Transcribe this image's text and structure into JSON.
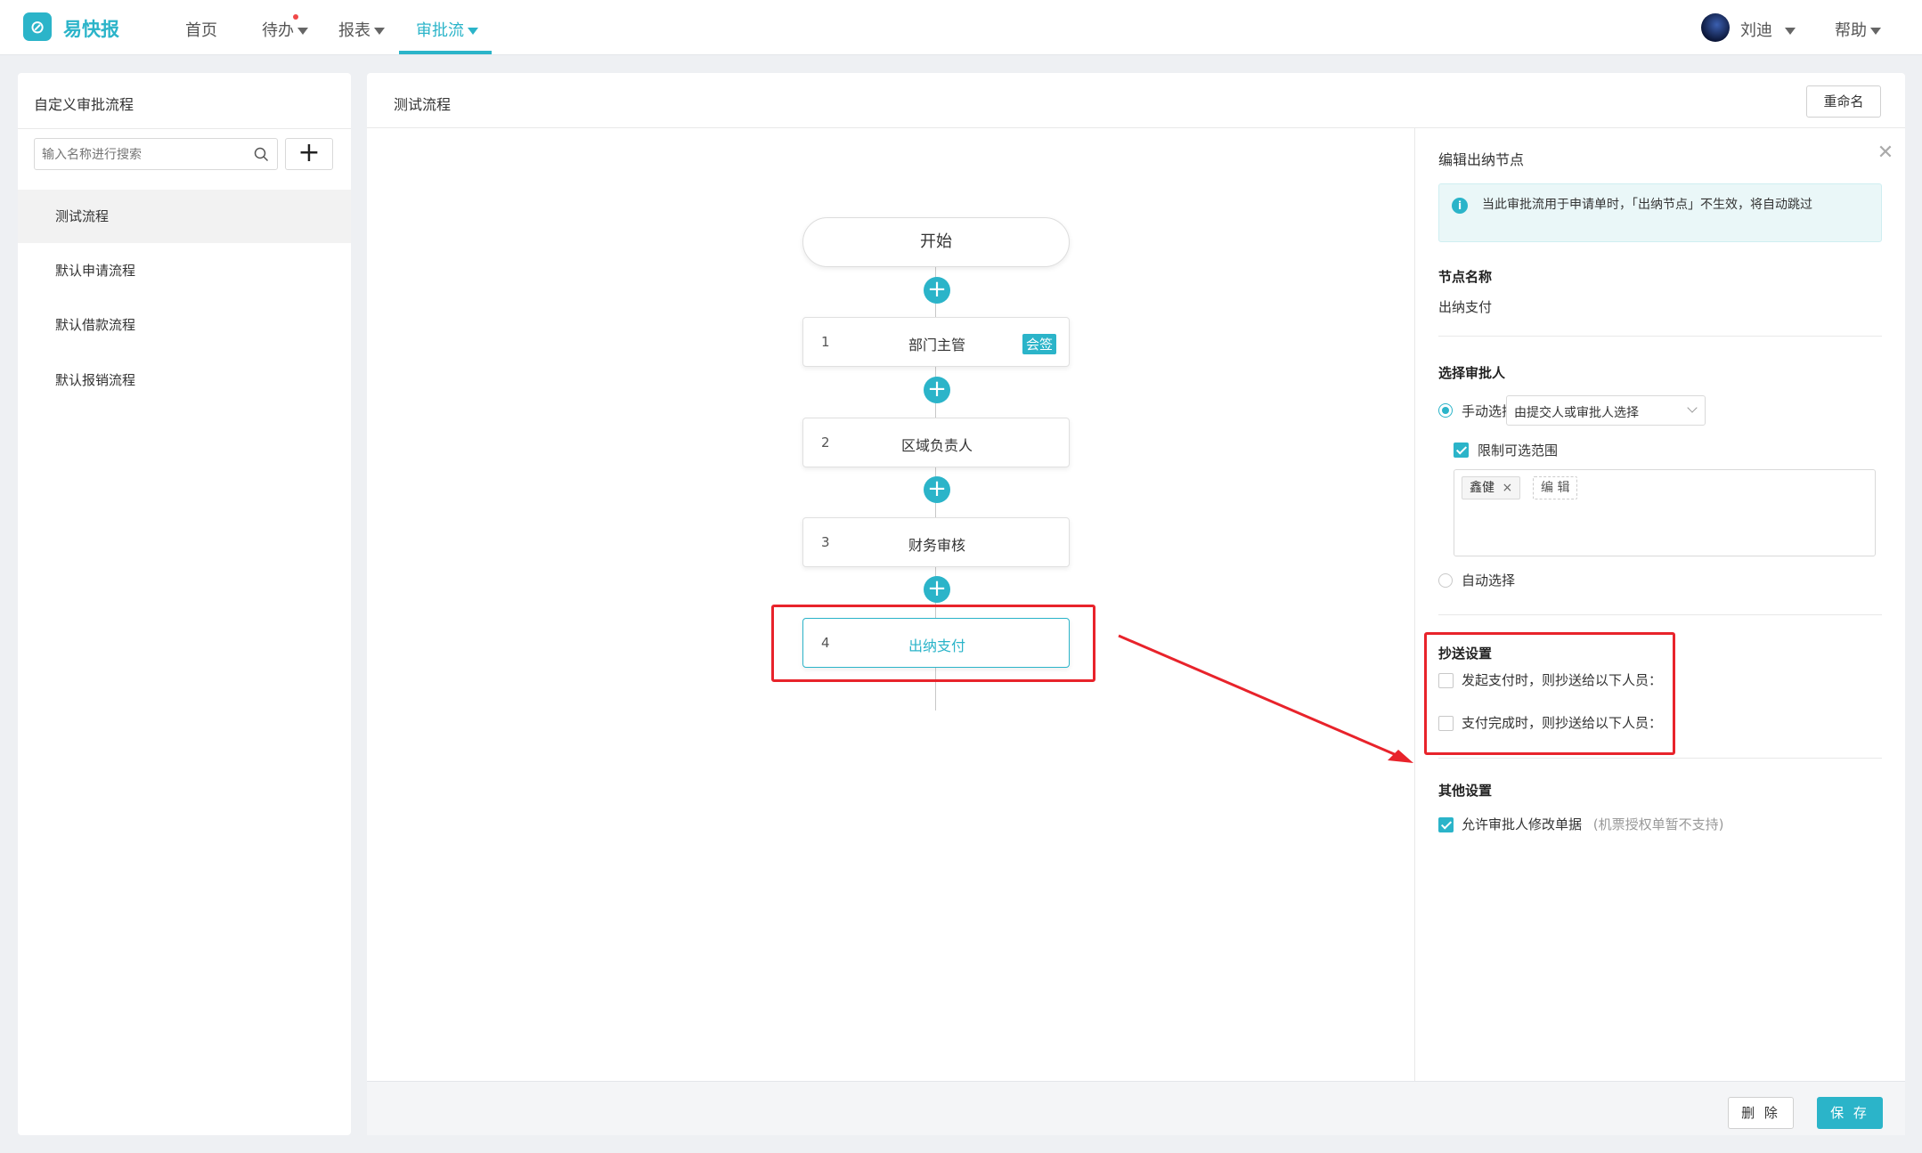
{
  "app": {
    "brand": "易快报",
    "logo_glyph": "⊘"
  },
  "nav": {
    "items": [
      {
        "label": "首页",
        "has_caret": false
      },
      {
        "label": "待办",
        "has_caret": true,
        "badge_dot": true
      },
      {
        "label": "报表",
        "has_caret": true
      },
      {
        "label": "审批流",
        "has_caret": true,
        "active": true
      }
    ],
    "user": {
      "name": "刘迪"
    },
    "help": "帮助"
  },
  "left_panel": {
    "title": "自定义审批流程",
    "search_placeholder": "输入名称进行搜索",
    "add_label": "+",
    "flows": [
      {
        "label": "测试流程",
        "selected": true
      },
      {
        "label": "默认申请流程"
      },
      {
        "label": "默认借款流程"
      },
      {
        "label": "默认报销流程"
      }
    ]
  },
  "main": {
    "title": "测试流程",
    "rename_label": "重命名",
    "start_label": "开始",
    "add_node_label": "+",
    "nodes": [
      {
        "index": "1",
        "name": "部门主管",
        "tag": "会签"
      },
      {
        "index": "2",
        "name": "区域负责人"
      },
      {
        "index": "3",
        "name": "财务审核"
      },
      {
        "index": "4",
        "name": "出纳支付",
        "selected": true
      }
    ],
    "delete_label": "删 除",
    "save_label": "保 存"
  },
  "edit_panel": {
    "title": "编辑出纳节点",
    "close_label": "✕",
    "notice": "当此审批流用于申请单时，「出纳节点」不生效，将自动跳过",
    "node_name_heading": "节点名称",
    "node_name_value": "出纳支付",
    "approver_heading": "选择审批人",
    "manual_label": "手动选择",
    "manual_checked": true,
    "manual_select_value": "由提交人或审批人选择",
    "limit_label": "限制可选范围",
    "limit_checked": true,
    "chip_label": "鑫健",
    "chip_remove": "×",
    "edit_label": "编 辑",
    "auto_label": "自动选择",
    "cc_heading": "抄送设置",
    "cc_on_start": "发起支付时，则抄送给以下人员：",
    "cc_on_done": "支付完成时，则抄送给以下人员：",
    "other_heading": "其他设置",
    "allow_modify_label": "允许审批人修改单据",
    "allow_modify_note": "(机票授权单暂不支持)",
    "allow_modify_checked": true
  },
  "colors": {
    "accent": "#2bb4c9",
    "highlight_red": "#e8232b"
  }
}
